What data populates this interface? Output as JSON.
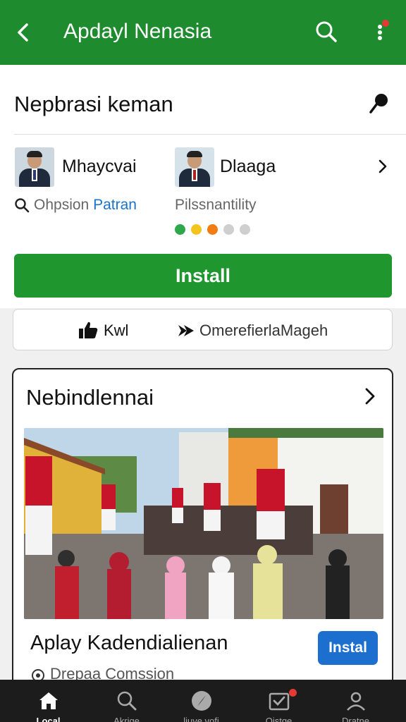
{
  "app_bar": {
    "title": "Apdayl Nenasia",
    "back_icon": "back-arrow-icon",
    "search_icon": "search-icon",
    "more_icon": "more-vert-icon",
    "notification_dot": true,
    "color": "#1e8b2e"
  },
  "card": {
    "heading": "Nepbrasi keman",
    "pin_icon": "pin-icon",
    "people": [
      {
        "name": "Mhaycvai",
        "sub_prefix": "Ohpsion",
        "sub_accent": "Patran",
        "icon": "search-icon"
      },
      {
        "name": "Dlaaga",
        "sub": "Pilssnantility"
      }
    ],
    "indicator_colors": [
      "#2ea84a",
      "#f3c41d",
      "#f07c12",
      "#cfcfcf",
      "#cfcfcf"
    ],
    "install_label": "Install",
    "install_color": "#1f962e"
  },
  "actions": {
    "like_label": "Kwl",
    "like_icon": "thumbs-up-icon",
    "share_label": "OmerefierlaMageh",
    "share_icon": "share-arrow-icon"
  },
  "feature": {
    "section_title": "Nebindlennai",
    "app_title": "Aplay Kadendialienan",
    "install_label": "Instal",
    "install_color": "#1c6fcf",
    "developer": "Drepaa Comssion",
    "developer_icon": "developer-icon",
    "image_icon": "street-parade-photo"
  },
  "bottom_nav": {
    "items": [
      {
        "label": "Local",
        "icon": "home-icon",
        "active": true
      },
      {
        "label": "Akrige",
        "icon": "search-icon"
      },
      {
        "label": "liuve vofi",
        "icon": "compass-icon"
      },
      {
        "label": "Ojstqe",
        "icon": "inbox-check-icon",
        "badge": true
      },
      {
        "label": "Dratne",
        "icon": "profile-icon"
      }
    ]
  }
}
